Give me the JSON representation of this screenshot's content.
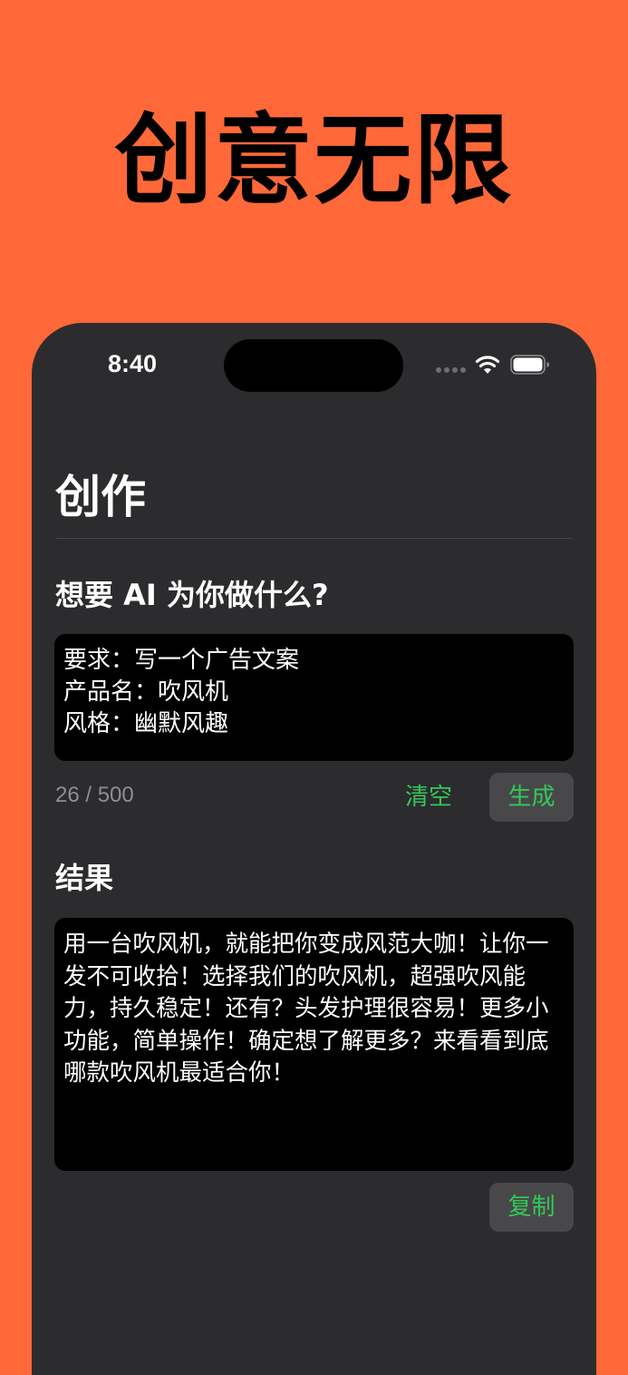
{
  "hero": {
    "title": "创意无限"
  },
  "status_bar": {
    "time": "8:40",
    "icons": [
      "signal-dots-icon",
      "wifi-icon",
      "battery-icon"
    ]
  },
  "page": {
    "title": "创作"
  },
  "prompt_section": {
    "label": "想要 AI 为你做什么?",
    "input_value": "要求：写一个广告文案\n产品名：吹风机\n风格：幽默风趣",
    "char_count": "26 / 500",
    "clear_label": "清空",
    "generate_label": "生成"
  },
  "result_section": {
    "label": "结果",
    "text": "用一台吹风机，就能把你变成风范大咖！让你一发不可收拾！选择我们的吹风机，超强吹风能力，持久稳定！还有？头发护理很容易！更多小功能，简单操作！确定想了解更多？来看看到底哪款吹风机最适合你！",
    "copy_label": "复制"
  },
  "colors": {
    "background": "#FF6838",
    "panel": "#2C2C2E",
    "field": "#000000",
    "accent": "#34C759",
    "button_bg": "#48484A",
    "muted_text": "#8E8E93"
  }
}
